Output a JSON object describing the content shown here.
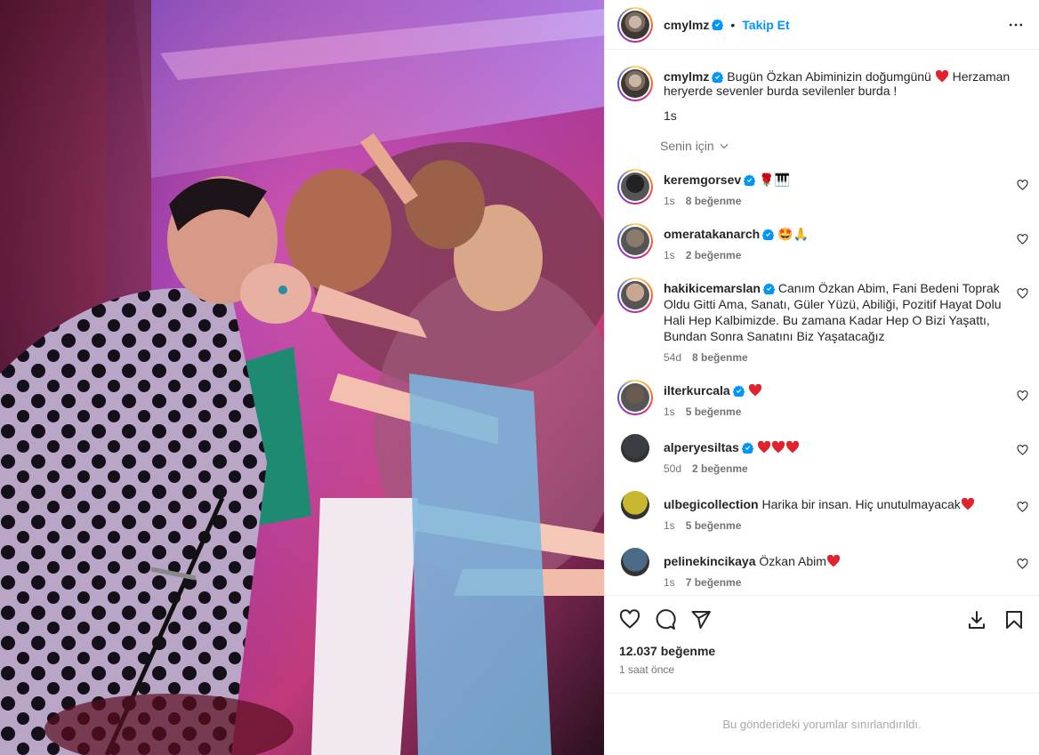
{
  "header": {
    "username": "cmylmz",
    "separator": "•",
    "follow_label": "Takip Et"
  },
  "caption": {
    "username": "cmylmz",
    "text_before": "Bugün Özkan Abiminizin doğumgünü",
    "text_after": "Herzaman heryerde sevenler burda sevilenler burda !",
    "time": "1s"
  },
  "filter_label": "Senin için",
  "comments": [
    {
      "username": "keremgorsev",
      "text": "🌹🎹",
      "time": "1s",
      "likes": "8 beğenme",
      "verified": true
    },
    {
      "username": "omeratakanarch",
      "text": "🤩🙏",
      "time": "1s",
      "likes": "2 beğenme",
      "verified": true
    },
    {
      "username": "hakikicemarslan",
      "text": "Canım Özkan Abim, Fani Bedeni Toprak Oldu Gitti Ama, Sanatı, Güler Yüzü, Abiliği, Pozitif Hayat Dolu Hali Hep Kalbimizde. Bu zamana Kadar Hep O Bizi Yaşattı, Bundan Sonra Sanatını Biz Yaşatacağız",
      "time": "54d",
      "likes": "8 beğenme",
      "verified": true
    },
    {
      "username": "ilterkurcala",
      "text": "",
      "hearts": 1,
      "time": "1s",
      "likes": "5 beğenme",
      "verified": true
    },
    {
      "username": "alperyesiltas",
      "text": "",
      "hearts": 3,
      "time": "50d",
      "likes": "2 beğenme",
      "verified": true
    },
    {
      "username": "ulbegicollection",
      "text": "Harika bir insan. Hiç unutulmayacak",
      "hearts": 1,
      "time": "1s",
      "likes": "5 beğenme",
      "verified": false
    },
    {
      "username": "pelinekincikaya",
      "text": "Özkan Abim",
      "hearts": 1,
      "time": "1s",
      "likes": "7 beğenme",
      "verified": false
    }
  ],
  "footer": {
    "likes_total": "12.037 beğenme",
    "time_ago": "1 saat önce",
    "limited_notice": "Bu gönderideki yorumlar sınırlandırıldı."
  },
  "colors": {
    "accent": "#0095f6",
    "heart": "#ed4956",
    "muted": "#737373"
  }
}
